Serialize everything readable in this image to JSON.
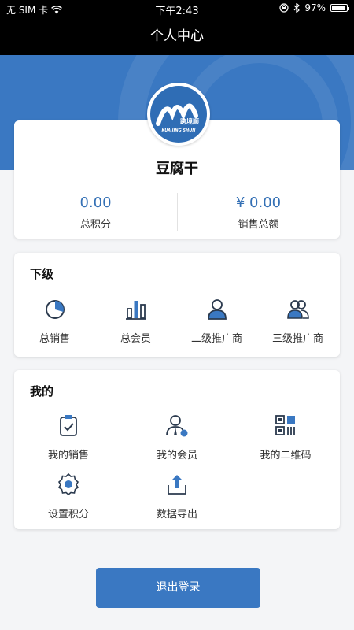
{
  "status_bar": {
    "carrier": "无 SIM 卡",
    "time": "下午2:43",
    "battery_text": "97%",
    "battery_level": 0.97
  },
  "nav": {
    "title": "个人中心"
  },
  "logo": {
    "text_cn": "跨境顺",
    "text_en": "KUA JING SHUN"
  },
  "profile": {
    "username": "豆腐干",
    "stats": [
      {
        "value": "0.00",
        "label": "总积分"
      },
      {
        "value": "¥ 0.00",
        "label": "销售总额"
      }
    ]
  },
  "subordinates": {
    "title": "下级",
    "items": [
      {
        "label": "总销售",
        "icon": "pie-chart-icon"
      },
      {
        "label": "总会员",
        "icon": "bar-chart-icon"
      },
      {
        "label": "二级推广商",
        "icon": "person-icon"
      },
      {
        "label": "三级推广商",
        "icon": "group-icon"
      }
    ]
  },
  "mine": {
    "title": "我的",
    "items": [
      {
        "label": "我的销售",
        "icon": "clipboard-check-icon"
      },
      {
        "label": "我的会员",
        "icon": "member-icon"
      },
      {
        "label": "我的二维码",
        "icon": "qrcode-icon"
      },
      {
        "label": "设置积分",
        "icon": "gear-icon"
      },
      {
        "label": "数据导出",
        "icon": "export-icon"
      }
    ]
  },
  "logout": {
    "label": "退出登录"
  },
  "colors": {
    "primary": "#3a78c2",
    "value_blue": "#3470b5",
    "icon_dark": "#2b3a4e"
  }
}
